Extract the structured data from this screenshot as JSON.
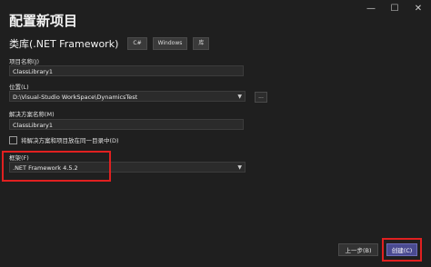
{
  "window": {
    "controls": [
      "—",
      "☐",
      "✕"
    ]
  },
  "page": {
    "title": "配置新项目",
    "project_type": "类库(.NET Framework)",
    "tags": [
      "C#",
      "Windows",
      "库"
    ]
  },
  "form": {
    "project_name_label": "项目名称(J)",
    "project_name_value": "ClassLibrary1",
    "location_label": "位置(L)",
    "location_value": "D:\\Visual-Studio WorkSpace\\DynamicsTest",
    "browse_label": "...",
    "solution_name_label": "解决方案名称(M)",
    "solution_name_value": "ClassLibrary1",
    "same_dir_checkbox_label": "将解决方案和项目放在同一目录中(D)",
    "framework_label": "框架(F)",
    "framework_value": ".NET Framework 4.5.2"
  },
  "buttons": {
    "back": "上一步(B)",
    "create": "创建(C)"
  },
  "colors": {
    "background": "#1f1f1f",
    "highlight": "#e02020",
    "primary_button": "#4a4a90"
  }
}
